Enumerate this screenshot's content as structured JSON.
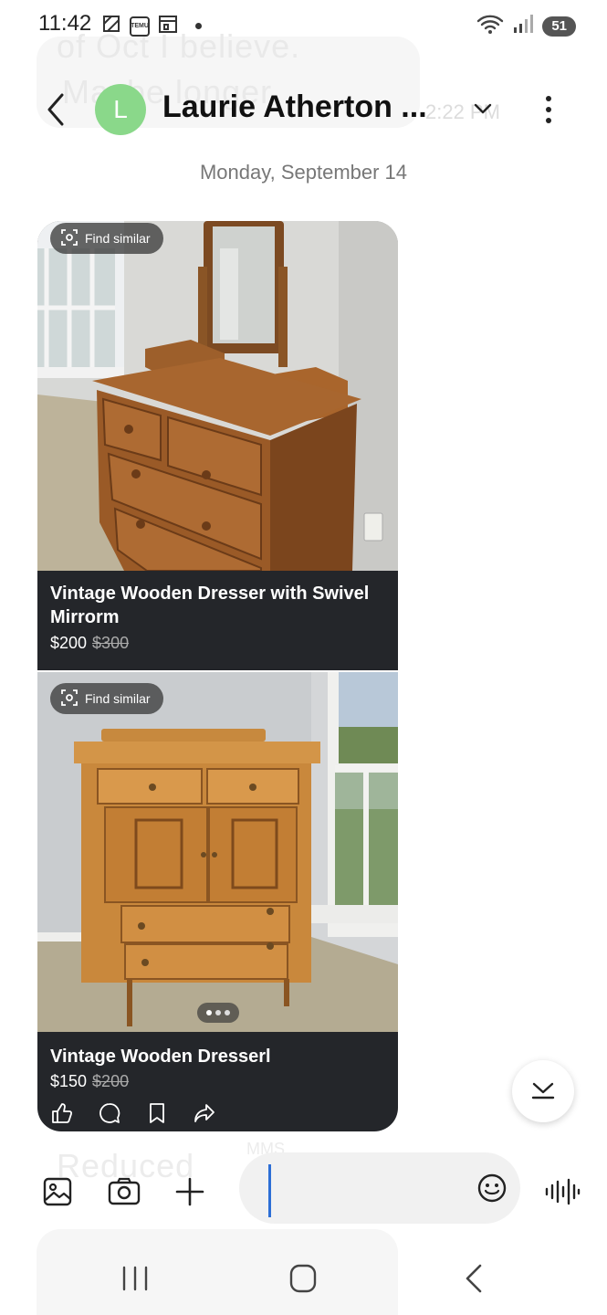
{
  "status_bar": {
    "time": "11:42",
    "battery": "51",
    "app_icon_1": "TEMU"
  },
  "header": {
    "contact_name": "Laurie Atherton ...",
    "avatar_initial": "L",
    "avatar_color": "#8ad88a"
  },
  "ghost": {
    "line1": "of Oct I believe.",
    "line2": "Maybe longer",
    "time": "2:22 PM",
    "reduced": "Reduced",
    "mms": "MMS"
  },
  "date_separator": "Monday, September 14",
  "cards": [
    {
      "find_similar": "Find similar",
      "title": "Vintage Wooden Dresser with Swivel Mirrorm",
      "price": "$200",
      "old_price": "$300"
    },
    {
      "find_similar": "Find similar",
      "title": "Vintage Wooden Dresserl",
      "price": "$150",
      "old_price": "$200"
    }
  ],
  "composer": {
    "input_value": ""
  },
  "colors": {
    "card_bg": "#24262a",
    "accent_caret": "#2d6fd6"
  }
}
